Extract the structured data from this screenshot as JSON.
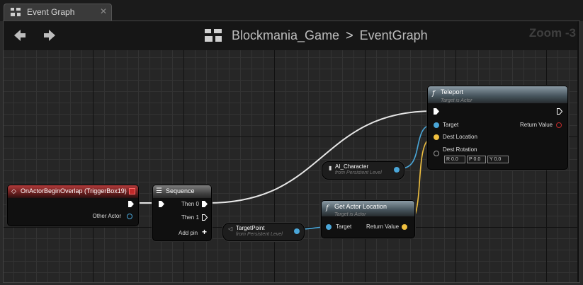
{
  "tab": {
    "title": "Event Graph",
    "icon": "graph-tab-icon",
    "close": "close-icon"
  },
  "header": {
    "back": "back-arrow-icon",
    "forward": "forward-arrow-icon",
    "breadcrumb": [
      "Blockmania_Game",
      ">",
      "EventGraph"
    ],
    "zoom": "Zoom -3"
  },
  "nodes": {
    "event": {
      "title": "OnActorBeginOverlap (TriggerBox19)",
      "pins": [
        "Other Actor"
      ]
    },
    "sequence": {
      "title": "Sequence",
      "pins": [
        "Then 0",
        "Then 1",
        "Add pin"
      ]
    },
    "target_point": {
      "title": "TargetPoint",
      "subtitle": "from Persistent Level"
    },
    "ai_character": {
      "title": "AI_Character",
      "subtitle": "from Persistent Level"
    },
    "get_actor_location": {
      "title": "Get Actor Location",
      "subtitle": "Target is Actor",
      "pins": [
        "Target",
        "Return Value"
      ]
    },
    "teleport": {
      "title": "Teleport",
      "subtitle": "Target is Actor",
      "pins": [
        "Target",
        "Return Value",
        "Dest Location",
        "Dest Rotation"
      ],
      "rotation": {
        "R": "R",
        "R_val": "0.0",
        "P": "P",
        "P_val": "0.0",
        "Y": "Y",
        "Y_val": "0.0"
      }
    }
  },
  "colors": {
    "exec_wire": "#e6e6e6",
    "object_wire": "#4aa6d8",
    "vector_wire": "#f0c040",
    "bool_pin": "#c02a2a"
  }
}
